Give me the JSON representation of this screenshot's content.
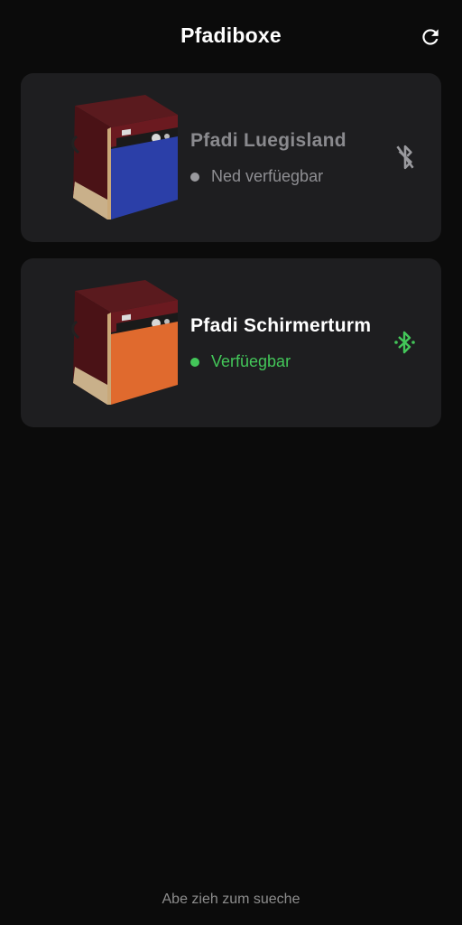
{
  "header": {
    "title": "Pfadiboxe",
    "refresh_icon": "refresh-icon"
  },
  "devices": [
    {
      "name": "Pfadi Luegisland",
      "status": "Ned verfüegbar",
      "available": false,
      "bluetooth_icon": "bluetooth-disabled-icon",
      "status_color": "#9a9a9e",
      "grille_color": "#2b3fa8"
    },
    {
      "name": "Pfadi Schirmerturm",
      "status": "Verfüegbar",
      "available": true,
      "bluetooth_icon": "bluetooth-searching-icon",
      "status_color": "#43c659",
      "grille_color": "#e06a2e"
    }
  ],
  "footer": {
    "hint": "Abe zieh zum sueche"
  }
}
